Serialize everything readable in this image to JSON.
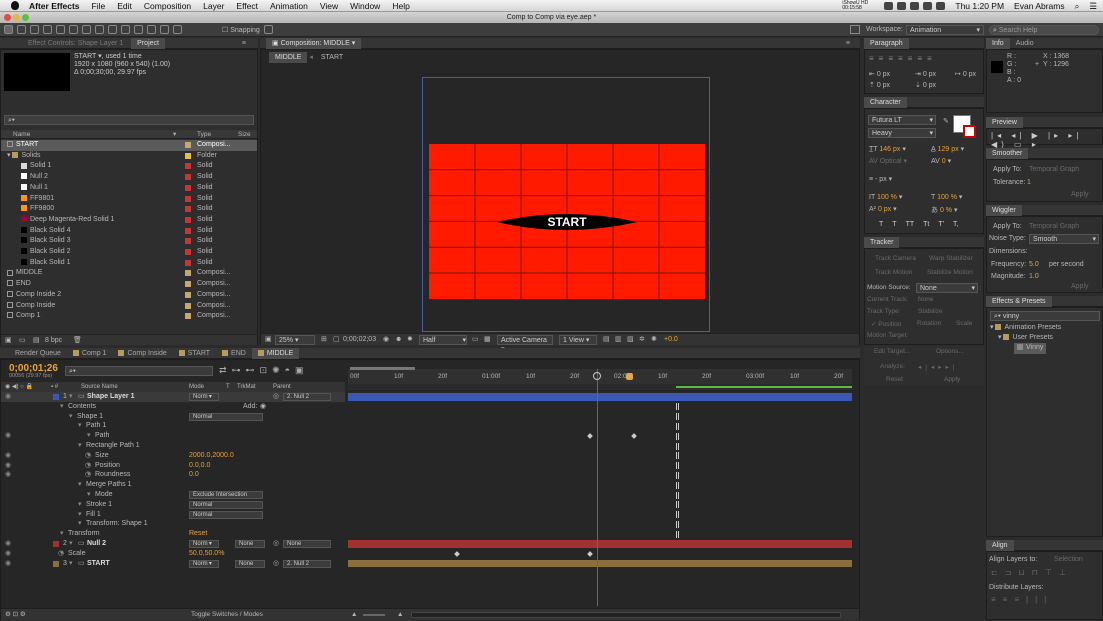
{
  "menubar": {
    "app": "After Effects",
    "items": [
      "File",
      "Edit",
      "Composition",
      "Layer",
      "Effect",
      "Animation",
      "View",
      "Window",
      "Help"
    ],
    "time": "Thu 1:20 PM",
    "user": "Evan Abrams",
    "status_text": "iShowU HD 00:15:58"
  },
  "title": "Comp to Comp via eye.aep *",
  "toolbar": {
    "snapping": "Snapping",
    "workspace_label": "Workspace:",
    "workspace": "Animation",
    "search": "Search Help"
  },
  "effect_controls_tab": "Effect Controls: Shape Layer 1",
  "project_tab": "Project",
  "project_info": {
    "name": "START ▾, used 1 time",
    "line2": "1920 x 1080 (960 x 540) (1.00)",
    "line3": "Δ 0;00;30;00, 29.97 fps"
  },
  "project_cols": {
    "name": "Name",
    "type": "Type",
    "size": "Size"
  },
  "project_items": [
    {
      "name": "START",
      "type": "Composi...",
      "color": "#c8a86a",
      "indent": 0,
      "sel": true
    },
    {
      "name": "Solids",
      "type": "Folder",
      "color": "#e8c040",
      "indent": 0,
      "folder": true
    },
    {
      "name": "Solid 1",
      "type": "Solid",
      "color": "#cc3333",
      "indent": 1,
      "sw": "#d8d8d8"
    },
    {
      "name": "Null 2",
      "type": "Solid",
      "color": "#cc3333",
      "indent": 1,
      "sw": "#ffffff"
    },
    {
      "name": "Null 1",
      "type": "Solid",
      "color": "#cc3333",
      "indent": 1,
      "sw": "#ffffff"
    },
    {
      "name": "FF9801",
      "type": "Solid",
      "color": "#cc3333",
      "indent": 1,
      "sw": "#ff9800"
    },
    {
      "name": "FF9800",
      "type": "Solid",
      "color": "#cc3333",
      "indent": 1,
      "sw": "#ff9800"
    },
    {
      "name": "Deep Magenta-Red Solid 1",
      "type": "Solid",
      "color": "#cc3333",
      "indent": 1,
      "sw": "#9a0040"
    },
    {
      "name": "Black Solid 4",
      "type": "Solid",
      "color": "#cc3333",
      "indent": 1,
      "sw": "#000"
    },
    {
      "name": "Black Solid 3",
      "type": "Solid",
      "color": "#cc3333",
      "indent": 1,
      "sw": "#000"
    },
    {
      "name": "Black Solid 2",
      "type": "Solid",
      "color": "#cc3333",
      "indent": 1,
      "sw": "#000"
    },
    {
      "name": "Black Solid 1",
      "type": "Solid",
      "color": "#cc3333",
      "indent": 1,
      "sw": "#000"
    },
    {
      "name": "MIDDLE",
      "type": "Composi...",
      "color": "#c8a86a",
      "indent": 0
    },
    {
      "name": "END",
      "type": "Composi...",
      "color": "#c8a86a",
      "indent": 0
    },
    {
      "name": "Comp Inside 2",
      "type": "Composi...",
      "color": "#c8a86a",
      "indent": 0
    },
    {
      "name": "Comp Inside",
      "type": "Composi...",
      "color": "#c8a86a",
      "indent": 0
    },
    {
      "name": "Comp 1",
      "type": "Composi...",
      "color": "#c8a86a",
      "indent": 0
    }
  ],
  "project_footer": {
    "bpc": "8 bpc"
  },
  "composition": {
    "tab": "Composition: MIDDLE",
    "crumbs": [
      "MIDDLE",
      "START"
    ],
    "zoom": "25%",
    "timecode": "0;00;02;03",
    "resolution": "Half",
    "camera": "Active Camera",
    "view": "1 View",
    "exposure": "+0.0",
    "text": "START",
    "bg": "#ff1a00"
  },
  "paragraph": {
    "tab": "Paragraph",
    "vals": [
      "0 px",
      "0 px",
      "0 px",
      "0 px",
      "0 px"
    ]
  },
  "character": {
    "tab": "Character",
    "font": "Futura LT",
    "style": "Heavy",
    "size": "146 px",
    "leading": "129 px",
    "kerning": "Optical",
    "tracking": "0",
    "stroke": "- px",
    "vscale": "100 %",
    "hscale": "100 %",
    "baseline": "0 px",
    "tsume": "0 %",
    "styles": [
      "T",
      "T",
      "TT",
      "Tt",
      "T'",
      "T,"
    ]
  },
  "info": {
    "tab": "Info",
    "audio": "Audio",
    "r": "R :",
    "g": "G :",
    "b": "B :",
    "a": "A : 0",
    "x": "X : 1368",
    "y": "Y : 1296"
  },
  "preview": {
    "tab": "Preview"
  },
  "smoother": {
    "tab": "Smoother",
    "apply_to": "Apply To:",
    "apply_val": "Temporal Graph",
    "tol_label": "Tolerance:",
    "tol": "1",
    "apply": "Apply"
  },
  "wiggler": {
    "tab": "Wiggler",
    "apply_to": "Apply To:",
    "apply_val": "Temporal Graph",
    "noise": "Noise Type:",
    "noise_val": "Smooth",
    "dims": "Dimensions:",
    "freq": "Frequency:",
    "freq_val": "5.0",
    "freq_unit": "per second",
    "mag": "Magnitude:",
    "mag_val": "1.0",
    "apply": "Apply"
  },
  "tracker": {
    "tab": "Tracker",
    "b1": "Track Camera",
    "b2": "Warp Stabilizer",
    "b3": "Track Motion",
    "b4": "Stabilize Motion",
    "src": "Motion Source:",
    "src_val": "None",
    "cur": "Current Track:",
    "cur_val": "None",
    "type": "Track Type:",
    "type_val": "Stabilize",
    "pos": "✓ Position",
    "rot": "Rotation",
    "scale": "Scale",
    "target": "Motion Target:",
    "edit": "Edit Target...",
    "options": "Options...",
    "analyze": "Analyze:",
    "reset": "Reset",
    "apply": "Apply"
  },
  "effects": {
    "tab": "Effects & Presets",
    "search": "vinny",
    "f1": "Animation Presets",
    "f2": "User Presets",
    "item": "Vinny"
  },
  "align": {
    "tab": "Align",
    "layers": "Align Layers to:",
    "sel": "Selection",
    "dist": "Distribute Layers:"
  },
  "timeline": {
    "tabs": [
      "Render Queue",
      "Comp 1",
      "Comp Inside",
      "START",
      "END",
      "MIDDLE"
    ],
    "timecode": "0;00;01;26",
    "fps": "00056 (29.97 fps)",
    "cols": {
      "src": "Source Name",
      "mode": "Mode",
      "t": "T",
      "trk": "TrkMat",
      "parent": "Parent"
    },
    "ruler": [
      "00f",
      "10f",
      "20f",
      "01:00f",
      "10f",
      "20f",
      "02:00f",
      "10f",
      "20f",
      "03:00f",
      "10f",
      "20f"
    ],
    "footer": "Toggle Switches / Modes",
    "layers": [
      {
        "num": "1",
        "name": "Shape Layer 1",
        "indent": 0,
        "mode": "Norm ▾",
        "parent": "2. Null 2",
        "bold": true,
        "bar": "#3b58b5"
      },
      {
        "name": "Contents",
        "indent": 1,
        "add": "Add:"
      },
      {
        "name": "Shape 1",
        "indent": 2,
        "mode": "Normal"
      },
      {
        "name": "Path 1",
        "indent": 3
      },
      {
        "name": "Path",
        "indent": 4
      },
      {
        "name": "Rectangle Path 1",
        "indent": 3
      },
      {
        "name": "Size",
        "indent": 4,
        "val": "2000.0,2000.0"
      },
      {
        "name": "Position",
        "indent": 4,
        "val": "0.0,0.0"
      },
      {
        "name": "Roundness",
        "indent": 4,
        "val": "0.0"
      },
      {
        "name": "Merge Paths 1",
        "indent": 3
      },
      {
        "name": "Mode",
        "indent": 4,
        "mode": "Exclude Intersection"
      },
      {
        "name": "Stroke 1",
        "indent": 3,
        "mode": "Normal"
      },
      {
        "name": "Fill 1",
        "indent": 3,
        "mode": "Normal"
      },
      {
        "name": "Transform: Shape 1",
        "indent": 3
      },
      {
        "name": "Transform",
        "indent": 1,
        "val": "Reset"
      },
      {
        "num": "2",
        "name": "Null 2",
        "indent": 0,
        "mode": "Norm ▾",
        "trk": "None",
        "parent": "None",
        "bold": true,
        "bar": "#a03232"
      },
      {
        "name": "Scale",
        "indent": 1,
        "val": "50.0,50.0%"
      },
      {
        "num": "3",
        "name": "START",
        "indent": 0,
        "mode": "Norm ▾",
        "trk": "None",
        "parent": "2. Null 2",
        "bold": true,
        "bar": "#8a6f3e"
      }
    ]
  }
}
